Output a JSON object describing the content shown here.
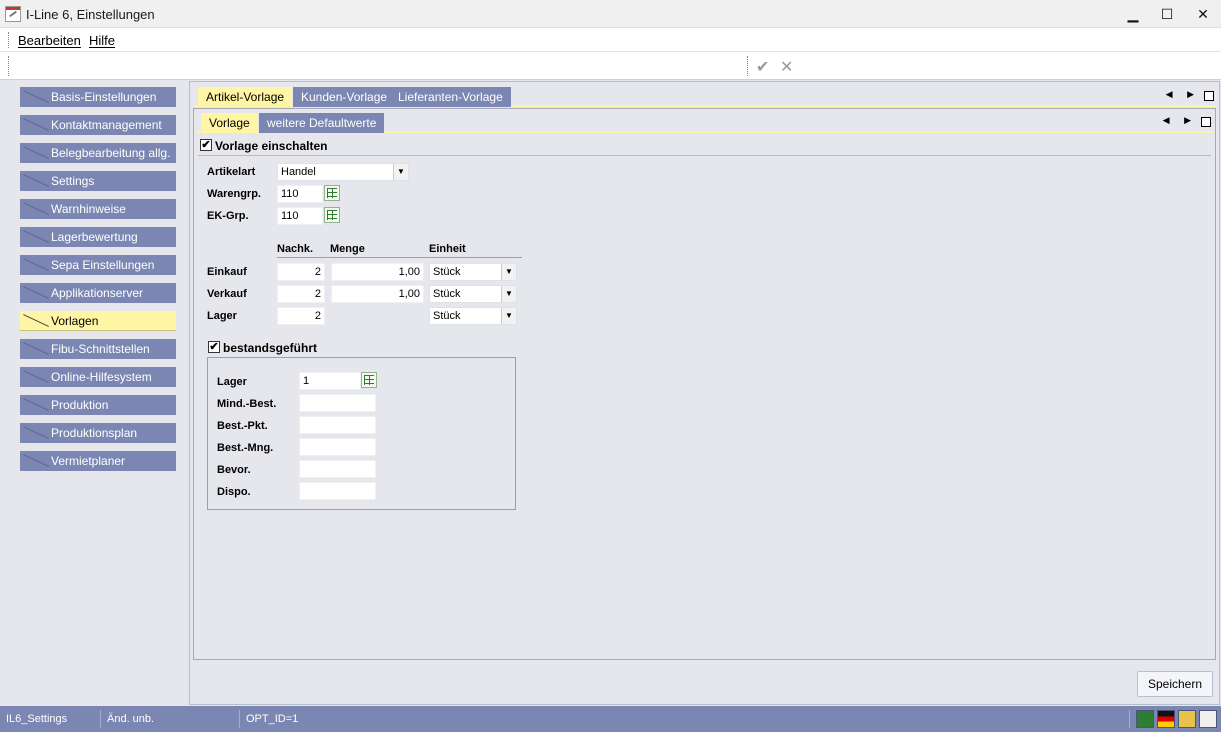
{
  "window": {
    "title": "I-Line 6, Einstellungen",
    "minimize": "▁",
    "maximize": "☐",
    "close": "✕"
  },
  "menu": {
    "items": [
      {
        "label": "Bearbeiten"
      },
      {
        "label": "Hilfe"
      }
    ]
  },
  "toolbar": {
    "confirm_icon": "✔",
    "cancel_icon": "✕"
  },
  "sidebar": {
    "items": [
      {
        "label": "Basis-Einstellungen"
      },
      {
        "label": "Kontaktmanagement"
      },
      {
        "label": "Belegbearbeitung allg."
      },
      {
        "label": "Settings"
      },
      {
        "label": "Warnhinweise"
      },
      {
        "label": "Lagerbewertung"
      },
      {
        "label": "Sepa Einstellungen"
      },
      {
        "label": "Applikationserver"
      },
      {
        "label": "Vorlagen",
        "active": true
      },
      {
        "label": "Fibu-Schnittstellen"
      },
      {
        "label": "Online-Hilfesystem"
      },
      {
        "label": "Produktion"
      },
      {
        "label": "Produktionsplan"
      },
      {
        "label": "Vermietplaner"
      }
    ]
  },
  "outer_tabs": [
    {
      "label": "Artikel-Vorlage",
      "active": true
    },
    {
      "label": "Kunden-Vorlage"
    },
    {
      "label": "Lieferanten-Vorlage"
    }
  ],
  "inner_tabs": [
    {
      "label": "Vorlage",
      "active": true
    },
    {
      "label": "weitere Defaultwerte"
    }
  ],
  "strip_arrows": "◀ ▶",
  "form": {
    "vorlage_checkbox": {
      "label": "Vorlage einschalten",
      "checked": true,
      "mark": "✔"
    },
    "artikelart": {
      "label": "Artikelart",
      "value": "Handel"
    },
    "warengrp": {
      "label": "Warengrp.",
      "value": "110"
    },
    "ekgrp": {
      "label": "EK-Grp.",
      "value": "110"
    },
    "units_table": {
      "headers": {
        "nachk": "Nachk.",
        "menge": "Menge",
        "einheit": "Einheit"
      },
      "rows": [
        {
          "label": "Einkauf",
          "nachk": "2",
          "menge": "1,00",
          "einheit": "Stück"
        },
        {
          "label": "Verkauf",
          "nachk": "2",
          "menge": "1,00",
          "einheit": "Stück"
        },
        {
          "label": "Lager",
          "nachk": "2",
          "menge": "",
          "einheit": "Stück"
        }
      ]
    },
    "bestand_checkbox": {
      "label": "bestandsgeführt",
      "checked": true,
      "mark": "✔"
    },
    "stock": {
      "lager": {
        "label": "Lager",
        "value": "1"
      },
      "mind_best": {
        "label": "Mind.-Best.",
        "value": ""
      },
      "best_pkt": {
        "label": "Best.-Pkt.",
        "value": ""
      },
      "best_mng": {
        "label": "Best.-Mng.",
        "value": ""
      },
      "bevor": {
        "label": "Bevor.",
        "value": ""
      },
      "dispo": {
        "label": "Dispo.",
        "value": ""
      }
    }
  },
  "save_button": {
    "label": "Speichern"
  },
  "statusbar": {
    "module": "IL6_Settings",
    "changes": "Änd. unb.",
    "opt_id": "OPT_ID=1"
  },
  "colors": {
    "nav_bg": "#7b87b2",
    "active_yellow": "#fef6a4",
    "panel_bg": "#e6e7ec"
  }
}
